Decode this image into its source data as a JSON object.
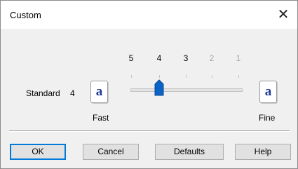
{
  "window": {
    "title": "Custom",
    "close_glyph": "✕"
  },
  "standard": {
    "label": "Standard",
    "value": "4"
  },
  "previews": {
    "left_letter": "a",
    "right_letter": "a",
    "letter_color": "#1f3a93"
  },
  "speed_labels": {
    "left": "Fast",
    "right": "Fine"
  },
  "slider": {
    "ticks": [
      "5",
      "4",
      "3",
      "2",
      "1"
    ],
    "selected": "4",
    "active_ticks": [
      "5",
      "4",
      "3"
    ]
  },
  "buttons": {
    "ok": "OK",
    "cancel": "Cancel",
    "defaults": "Defaults",
    "help": "Help"
  },
  "colors": {
    "thumb": "#0a64c8",
    "focus_border": "#0078d7"
  }
}
